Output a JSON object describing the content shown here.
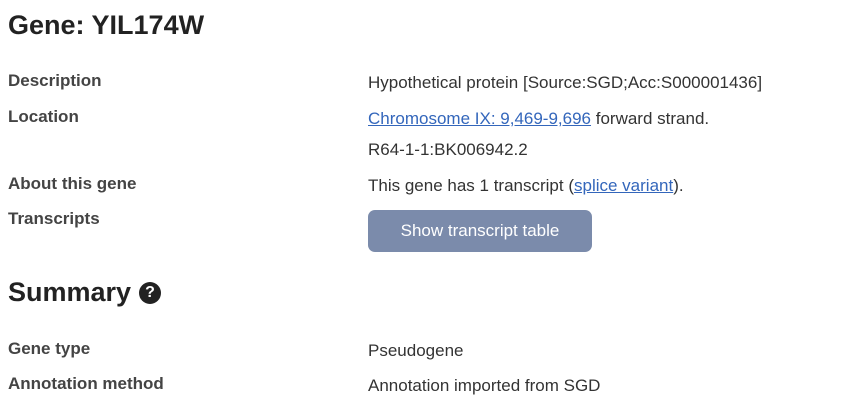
{
  "gene": {
    "title": "Gene: YIL174W"
  },
  "details": {
    "description_label": "Description",
    "description_value": "Hypothetical protein [Source:SGD;Acc:S000001436]",
    "location_label": "Location",
    "location_link": "Chromosome IX: 9,469-9,696",
    "location_suffix": " forward strand.",
    "location_assembly": "R64-1-1:BK006942.2",
    "about_label": "About this gene",
    "about_prefix": "This gene has 1 transcript (",
    "about_link": "splice variant",
    "about_suffix": ").",
    "transcripts_label": "Transcripts",
    "transcripts_button": "Show transcript table"
  },
  "summary": {
    "title": "Summary",
    "help_icon": "?",
    "gene_type_label": "Gene type",
    "gene_type_value": "Pseudogene",
    "annotation_label": "Annotation method",
    "annotation_value": "Annotation imported from SGD"
  },
  "colors": {
    "link": "#3366bb",
    "button_bg": "#7b8bab",
    "heading": "#222222"
  }
}
